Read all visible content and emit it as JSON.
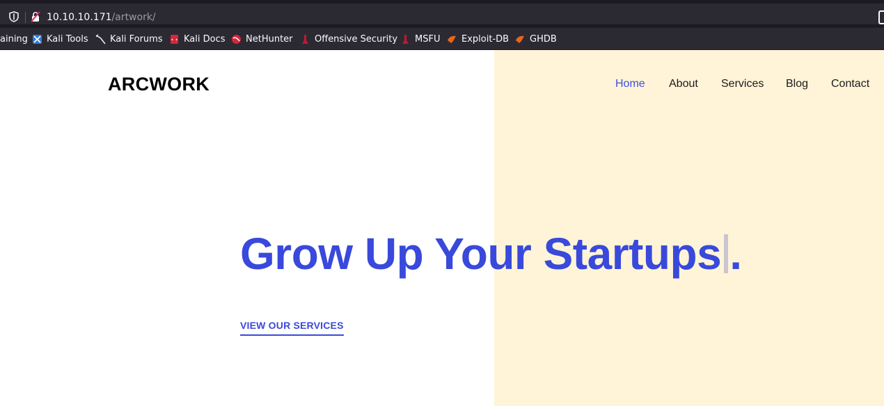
{
  "browser": {
    "url_host": "10.10.10.171",
    "url_path": "/artwork/",
    "bookmarks": [
      {
        "label": "aining",
        "icon": "truncated-bookmark"
      },
      {
        "label": "Kali Tools",
        "icon": "kali-tools-icon"
      },
      {
        "label": "Kali Forums",
        "icon": "kali-dragon-icon"
      },
      {
        "label": "Kali Docs",
        "icon": "kali-docs-icon"
      },
      {
        "label": "NetHunter",
        "icon": "nethunter-icon"
      },
      {
        "label": "Offensive Security",
        "icon": "offsec-icon"
      },
      {
        "label": "MSFU",
        "icon": "offsec-icon"
      },
      {
        "label": "Exploit-DB",
        "icon": "exploitdb-icon"
      },
      {
        "label": "GHDB",
        "icon": "exploitdb-icon"
      }
    ]
  },
  "site": {
    "logo": "ARCWORK",
    "nav": [
      {
        "label": "Home",
        "active": true
      },
      {
        "label": "About",
        "active": false
      },
      {
        "label": "Services",
        "active": false
      },
      {
        "label": "Blog",
        "active": false
      },
      {
        "label": "Contact",
        "active": false
      }
    ],
    "headline_main": "Grow Up Your Startups",
    "headline_end": ".",
    "cta": "VIEW OUR SERVICES"
  },
  "colors": {
    "accent": "#3949db",
    "hero_panel": "#fff4d8",
    "chrome_dark": "#1c1b22",
    "chrome": "#2b2a33"
  }
}
